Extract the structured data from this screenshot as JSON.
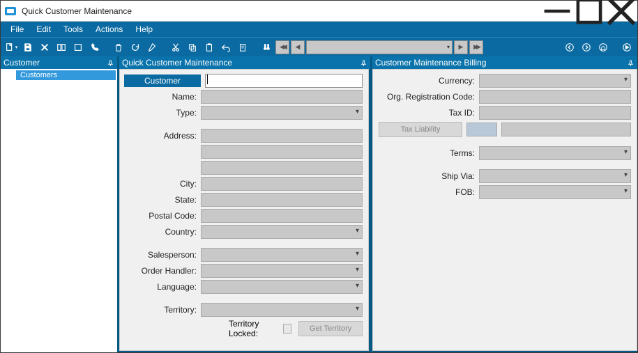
{
  "window": {
    "title": "Quick Customer Maintenance"
  },
  "menu": {
    "file": "File",
    "edit": "Edit",
    "tools": "Tools",
    "actions": "Actions",
    "help": "Help"
  },
  "panels": {
    "left_title": "Customer",
    "center_title": "Quick Customer Maintenance",
    "right_title": "Customer Maintenance Billing"
  },
  "tree": {
    "customers": "Customers"
  },
  "form": {
    "customer_tab": "Customer",
    "name": "Name:",
    "type": "Type:",
    "address": "Address:",
    "city": "City:",
    "state": "State:",
    "postal": "Postal Code:",
    "country": "Country:",
    "salesperson": "Salesperson:",
    "orderhandler": "Order Handler:",
    "language": "Language:",
    "territory": "Territory:",
    "territory_locked": "Territory Locked:",
    "get_territory": "Get Territory"
  },
  "billing": {
    "currency": "Currency:",
    "orgreg": "Org. Registration Code:",
    "taxid": "Tax ID:",
    "taxliab": "Tax Liability",
    "terms": "Terms:",
    "shipvia": "Ship Via:",
    "fob": "FOB:"
  }
}
